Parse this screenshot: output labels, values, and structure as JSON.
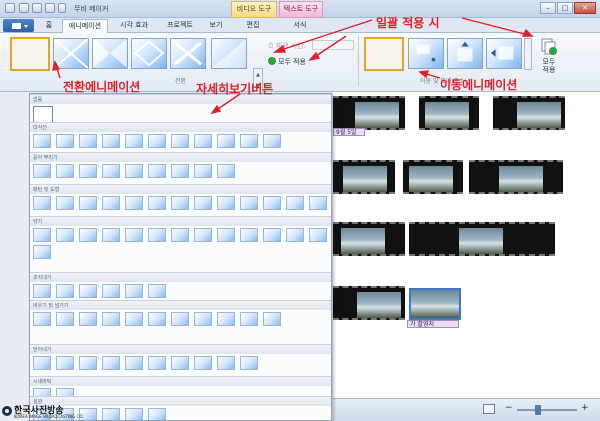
{
  "window": {
    "title": "무비 메이커",
    "minimize": "–",
    "maximize": "□",
    "close": "✕"
  },
  "context_headers": {
    "video_tools": "비디오 도구",
    "text_tools": "텍스트 도구"
  },
  "tabs": [
    {
      "label": "홈"
    },
    {
      "label": "애니메이션"
    },
    {
      "label": "시각 효과"
    },
    {
      "label": "프로젝트"
    },
    {
      "label": "보기"
    },
    {
      "label": "편집"
    },
    {
      "label": "서식"
    }
  ],
  "ribbon": {
    "transitions_group": "전환",
    "duration_label": "재생 시간:",
    "apply_all": "모두 적용",
    "pan_zoom_group": "이동 및 확대/축소",
    "apply_all_big": "모두\n적용"
  },
  "annotations": {
    "apply_all_callout": "일괄 적용 시",
    "transition_animation": "전환에니메이션",
    "more_button": "자세히보기버튼",
    "pan_animation": "이동에니메이션"
  },
  "dropdown": {
    "sections": [
      {
        "title": "없음",
        "count": 1
      },
      {
        "title": "대각선",
        "count": 11
      },
      {
        "title": "흩어 뿌리기",
        "count": 9
      },
      {
        "title": "패턴 및 도형",
        "count": 14
      },
      {
        "title": "닦기",
        "count": 14
      },
      {
        "title": "조각내기",
        "count": 6
      },
      {
        "title": "비우기 및 넘기기",
        "count": 11
      },
      {
        "title": "닫아내기",
        "count": 10
      },
      {
        "title": "시네마틱",
        "count": 2
      },
      {
        "title": "섬광",
        "count": 6
      }
    ]
  },
  "storyboard": {
    "date_caption": "9월 5일",
    "clip_caption": "가 촬영지"
  },
  "statusbar": {
    "zoom_out": "−",
    "zoom_in": "+",
    "zoom_level": 0.35
  },
  "watermark": {
    "name": "한국사진방송",
    "sub": "KOREA IMAGE BROADCASTING CO."
  }
}
